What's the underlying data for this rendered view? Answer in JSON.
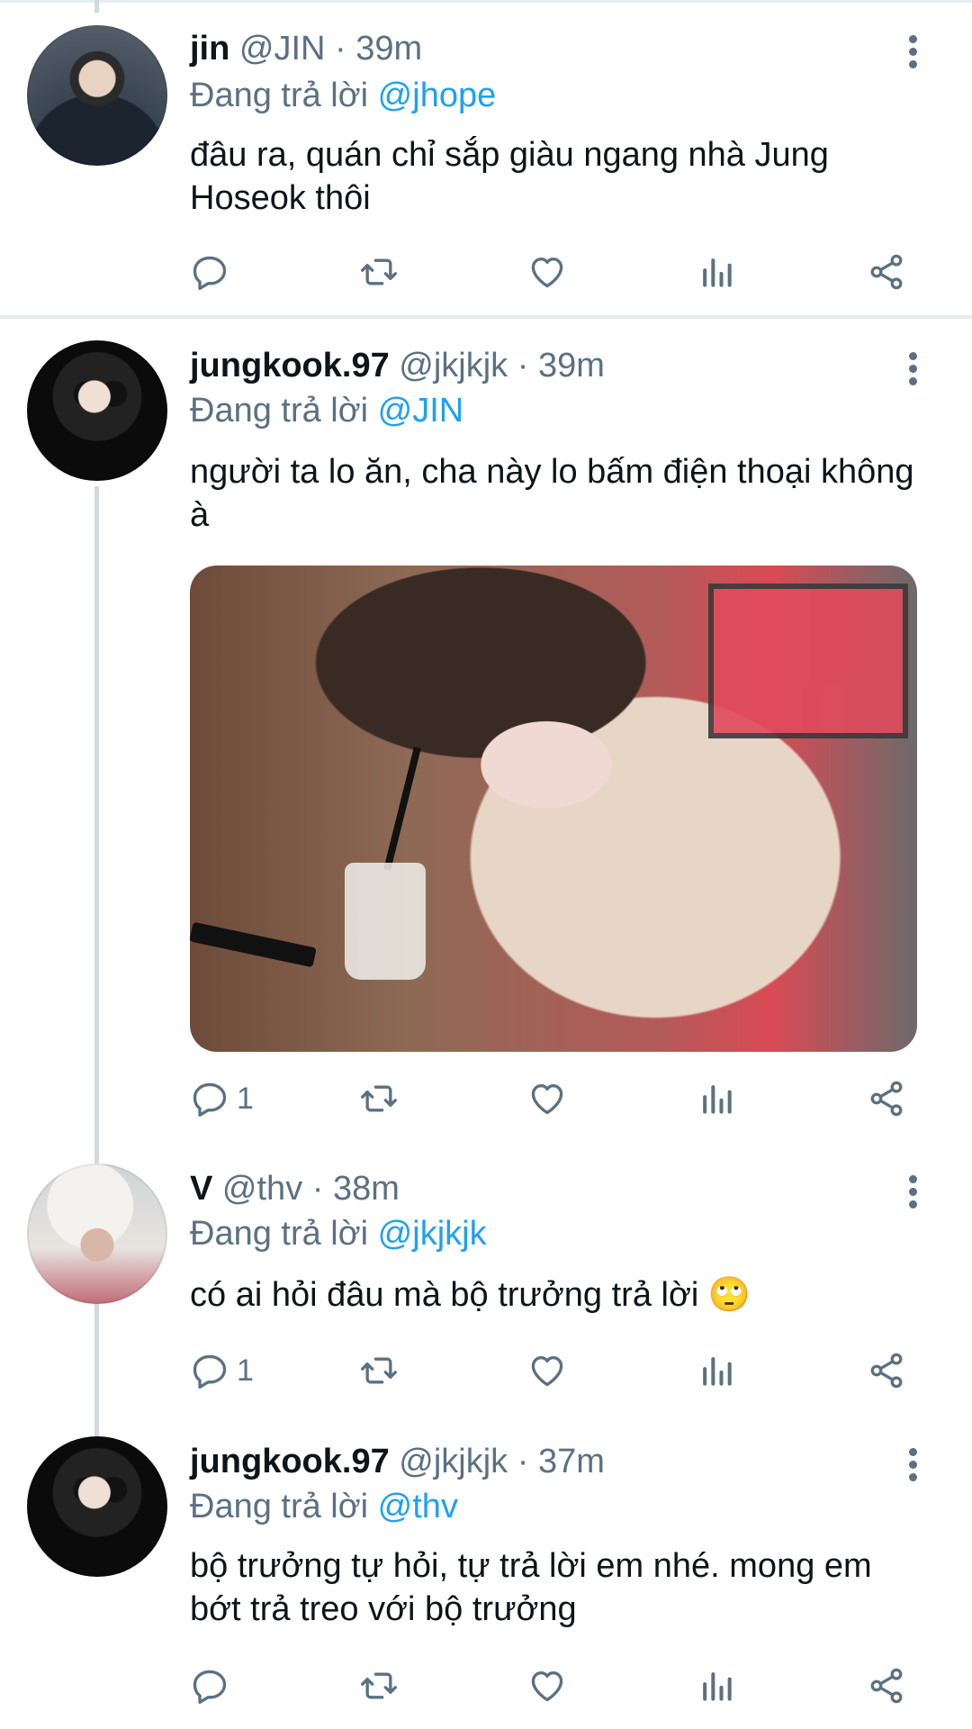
{
  "tweets": [
    {
      "name": "jin",
      "handle_time": "@JIN · 39m",
      "reply_prefix": "Đang trả lời ",
      "reply_to": "@jhope",
      "text": "đâu ra, quán chỉ sắp giàu ngang nhà Jung Hoseok thôi",
      "reply_count": ""
    },
    {
      "name": "jungkook.97",
      "handle_time": "@jkjkjk · 39m",
      "reply_prefix": "Đang trả lời ",
      "reply_to": "@JIN",
      "text": "người ta lo ăn, cha này lo bấm điện thoại không à",
      "reply_count": "1"
    },
    {
      "name": "V",
      "handle_time": "@thv · 38m",
      "reply_prefix": "Đang trả lời ",
      "reply_to": "@jkjkjk",
      "text": "có ai hỏi đâu mà bộ trưởng trả lời 🙄",
      "reply_count": "1"
    },
    {
      "name": "jungkook.97",
      "handle_time": "@jkjkjk · 37m",
      "reply_prefix": "Đang trả lời ",
      "reply_to": "@thv",
      "text": "bộ trưởng tự hỏi, tự trả lời em nhé. mong em bớt trả treo với bộ trưởng",
      "reply_count": ""
    }
  ],
  "icons": [
    "reply-icon",
    "retweet-icon",
    "like-icon",
    "analytics-icon",
    "share-icon",
    "more-icon"
  ],
  "colors": {
    "mention": "#1da1f2",
    "secondary_text": "#5b7083",
    "primary_text": "#0f1419",
    "thread_line": "#cfd9de"
  }
}
